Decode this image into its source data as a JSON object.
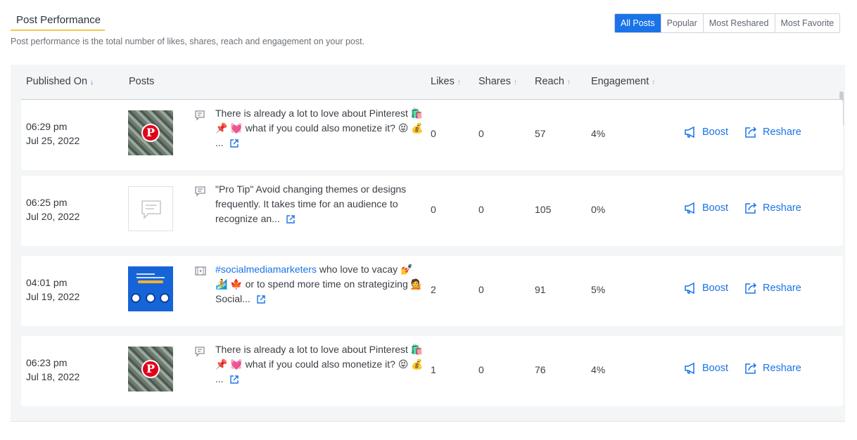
{
  "header": {
    "title": "Post Performance",
    "subtitle": "Post performance is the total number of likes, shares, reach and engagement on your post."
  },
  "filters": [
    "All Posts",
    "Popular",
    "Most Reshared",
    "Most Favorite"
  ],
  "active_filter": "All Posts",
  "table": {
    "columns": {
      "published_on": "Published On",
      "posts": "Posts",
      "likes": "Likes",
      "shares": "Shares",
      "reach": "Reach",
      "engagement": "Engagement"
    },
    "sort_icons": {
      "active": "↓",
      "inactive": "↑"
    },
    "actions": {
      "boost": "Boost",
      "reshare": "Reshare"
    },
    "rows": [
      {
        "time": "06:29 pm",
        "date": "Jul 25, 2022",
        "thumb": "pinterest-money-image",
        "post_type_icon": "text-image-post-icon",
        "text_before": "",
        "hashtag": "",
        "text_after": "There is already a lot to love about Pinterest 🛍️ 📌 💓 what if you could also monetize it? 😝 💰 ...",
        "likes": "0",
        "shares": "0",
        "reach": "57",
        "engagement": "4%"
      },
      {
        "time": "06:25 pm",
        "date": "Jul 20, 2022",
        "thumb": "text-post-placeholder",
        "post_type_icon": "text-post-icon",
        "text_before": "",
        "hashtag": "",
        "text_after": "\"Pro Tip\" Avoid changing themes or designs frequently. It takes time for an audience to recognize an...",
        "likes": "0",
        "shares": "0",
        "reach": "105",
        "engagement": "0%"
      },
      {
        "time": "04:01 pm",
        "date": "Jul 19, 2022",
        "thumb": "blue-social-graphic",
        "post_type_icon": "video-post-icon",
        "text_before": "",
        "hashtag": "#socialmediamarketers",
        "text_after": " who love to vacay 💅 🏄 🍁 or to spend more time on strategizing 💁 Social...",
        "likes": "2",
        "shares": "0",
        "reach": "91",
        "engagement": "5%"
      },
      {
        "time": "06:23 pm",
        "date": "Jul 18, 2022",
        "thumb": "pinterest-money-image",
        "post_type_icon": "text-image-post-icon",
        "text_before": "",
        "hashtag": "",
        "text_after": "There is already a lot to love about Pinterest 🛍️ 📌 💓 what if you could also monetize it? 😝 💰 ...",
        "likes": "1",
        "shares": "0",
        "reach": "76",
        "engagement": "4%"
      }
    ]
  },
  "colors": {
    "accent": "#1a73e8",
    "underline": "#f2c94c",
    "panel": "#f4f5f7"
  }
}
